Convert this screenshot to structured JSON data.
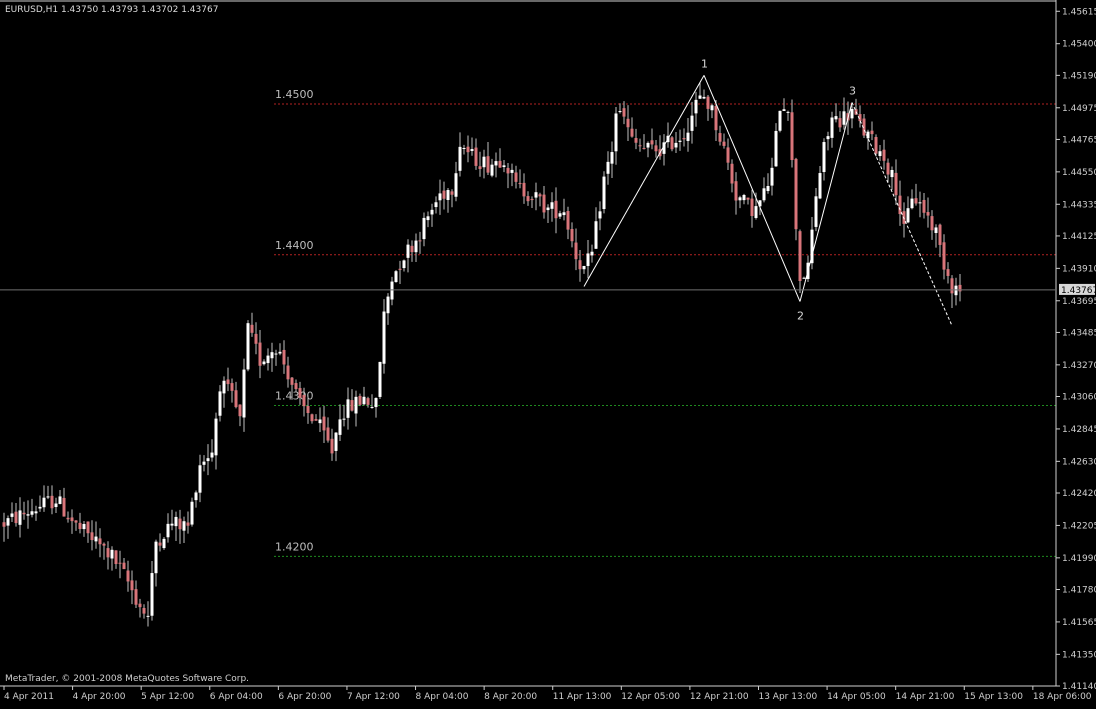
{
  "chart_data": {
    "type": "candlestick",
    "symbol_header": "EURUSD,H1  1.43750 1.43793 1.43702 1.43767",
    "current_price": 1.43767,
    "current_price_label": "1.43767",
    "ylim": [
      1.4114,
      1.4565
    ],
    "y_ticks": [
      "1.45615",
      "1.45400",
      "1.45190",
      "1.44975",
      "1.44765",
      "1.44550",
      "1.44335",
      "1.44125",
      "1.43910",
      "1.43695",
      "1.43485",
      "1.43270",
      "1.43060",
      "1.42845",
      "1.42630",
      "1.42420",
      "1.42205",
      "1.41990",
      "1.41780",
      "1.41565",
      "1.41350",
      "1.41140"
    ],
    "x_ticks": [
      "4 Apr 2011",
      "4 Apr 20:00",
      "5 Apr 12:00",
      "6 Apr 04:00",
      "6 Apr 20:00",
      "7 Apr 12:00",
      "8 Apr 04:00",
      "8 Apr 20:00",
      "11 Apr 13:00",
      "12 Apr 05:00",
      "12 Apr 21:00",
      "13 Apr 13:00",
      "14 Apr 05:00",
      "14 Apr 21:00",
      "15 Apr 13:00",
      "18 Apr 06:00"
    ],
    "bars_total": 240,
    "levels": [
      {
        "label": "1.4500",
        "value": 1.45,
        "color": "#b22222"
      },
      {
        "label": "1.4400",
        "value": 1.44,
        "color": "#b22222"
      },
      {
        "label": "1.4300",
        "value": 1.43,
        "color": "#1f8a1f"
      },
      {
        "label": "1.4200",
        "value": 1.42,
        "color": "#1f8a1f"
      }
    ],
    "wave_points": [
      {
        "bar": 145,
        "price": 1.4379,
        "label": ""
      },
      {
        "bar": 175,
        "price": 1.4519,
        "label": "1"
      },
      {
        "bar": 199,
        "price": 1.4369,
        "label": "2"
      },
      {
        "bar": 212,
        "price": 1.4501,
        "label": "3"
      },
      {
        "bar": 237,
        "price": 1.4353,
        "label": ""
      }
    ],
    "price_path": [
      [
        0,
        1.4222
      ],
      [
        8,
        1.4232
      ],
      [
        13,
        1.4238
      ],
      [
        18,
        1.422
      ],
      [
        22,
        1.4212
      ],
      [
        27,
        1.42
      ],
      [
        31,
        1.4183
      ],
      [
        34,
        1.4167
      ],
      [
        36,
        1.416
      ],
      [
        38,
        1.421
      ],
      [
        42,
        1.4222
      ],
      [
        46,
        1.422
      ],
      [
        49,
        1.4262
      ],
      [
        52,
        1.427
      ],
      [
        54,
        1.4315
      ],
      [
        57,
        1.4305
      ],
      [
        59,
        1.429
      ],
      [
        61,
        1.435
      ],
      [
        64,
        1.433
      ],
      [
        68,
        1.434
      ],
      [
        71,
        1.4322
      ],
      [
        74,
        1.43
      ],
      [
        78,
        1.429
      ],
      [
        82,
        1.427
      ],
      [
        84,
        1.4295
      ],
      [
        87,
        1.43
      ],
      [
        90,
        1.4305
      ],
      [
        93,
        1.43
      ],
      [
        95,
        1.436
      ],
      [
        97,
        1.4385
      ],
      [
        100,
        1.44
      ],
      [
        103,
        1.441
      ],
      [
        106,
        1.4425
      ],
      [
        109,
        1.444
      ],
      [
        112,
        1.4445
      ],
      [
        114,
        1.4475
      ],
      [
        117,
        1.4465
      ],
      [
        121,
        1.446
      ],
      [
        125,
        1.4465
      ],
      [
        128,
        1.4445
      ],
      [
        132,
        1.444
      ],
      [
        136,
        1.443
      ],
      [
        140,
        1.443
      ],
      [
        143,
        1.44
      ],
      [
        145,
        1.439
      ],
      [
        147,
        1.44
      ],
      [
        150,
        1.445
      ],
      [
        152,
        1.447
      ],
      [
        153,
        1.4495
      ],
      [
        155,
        1.449
      ],
      [
        157,
        1.4475
      ],
      [
        160,
        1.447
      ],
      [
        164,
        1.447
      ],
      [
        167,
        1.4475
      ],
      [
        170,
        1.448
      ],
      [
        173,
        1.45
      ],
      [
        175,
        1.4505
      ],
      [
        177,
        1.4495
      ],
      [
        180,
        1.447
      ],
      [
        183,
        1.444
      ],
      [
        186,
        1.4432
      ],
      [
        188,
        1.443
      ],
      [
        190,
        1.444
      ],
      [
        192,
        1.4455
      ],
      [
        194,
        1.45
      ],
      [
        196,
        1.45
      ],
      [
        198,
        1.442
      ],
      [
        199,
        1.4385
      ],
      [
        201,
        1.439
      ],
      [
        203,
        1.444
      ],
      [
        205,
        1.447
      ],
      [
        207,
        1.449
      ],
      [
        209,
        1.449
      ],
      [
        212,
        1.4495
      ],
      [
        214,
        1.4485
      ],
      [
        217,
        1.4475
      ],
      [
        220,
        1.4465
      ],
      [
        223,
        1.4445
      ],
      [
        225,
        1.4415
      ],
      [
        227,
        1.444
      ],
      [
        230,
        1.443
      ],
      [
        233,
        1.4415
      ],
      [
        235,
        1.4395
      ],
      [
        237,
        1.438
      ],
      [
        239,
        1.4376
      ]
    ]
  },
  "footer": {
    "copyright": "MetaTrader, © 2001-2008 MetaQuotes Software Corp."
  },
  "colors": {
    "background": "#000000",
    "bull": "#ffffff",
    "bear": "#d9757a",
    "wick": "#bfbfbf",
    "axis": "#cfcfcf",
    "wave": "#ffffff"
  }
}
